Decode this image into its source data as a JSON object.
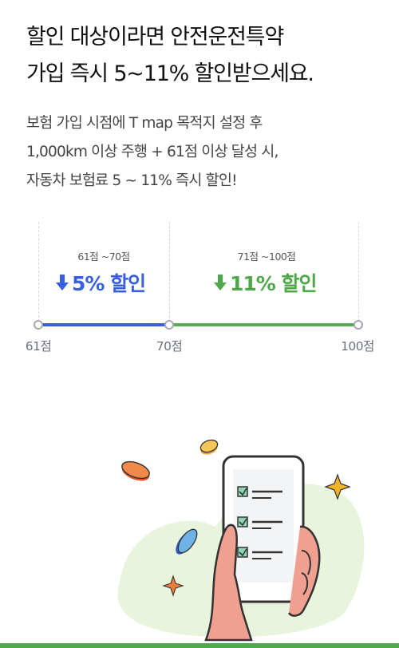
{
  "headline": {
    "line1": "할인 대상이라면 안전운전특약",
    "line2": "가입 즉시 5~11% 할인받으세요."
  },
  "description": {
    "line1": "보험 가입 시점에 T map 목적지 설정 후",
    "line2": "1,000km 이상 주행 + 61점 이상 달성 시,",
    "line3": "자동차 보험료 5 ~ 11% 즉시 할인!"
  },
  "tiers": [
    {
      "range": "61점 ~70점",
      "discount": "5% 할인",
      "color": "#3a5fdc"
    },
    {
      "range": "71점 ~100점",
      "discount": "11% 할인",
      "color": "#4ea84a"
    }
  ],
  "scale": {
    "start": "61점",
    "middle": "70점",
    "end": "100점"
  },
  "icons": {
    "down_arrow": "down-arrow-icon",
    "illustration": "phone-checklist-illustration"
  },
  "colors": {
    "blue": "#3a5fdc",
    "green": "#4ea84a",
    "bottom_bar": "#4caa4a"
  }
}
